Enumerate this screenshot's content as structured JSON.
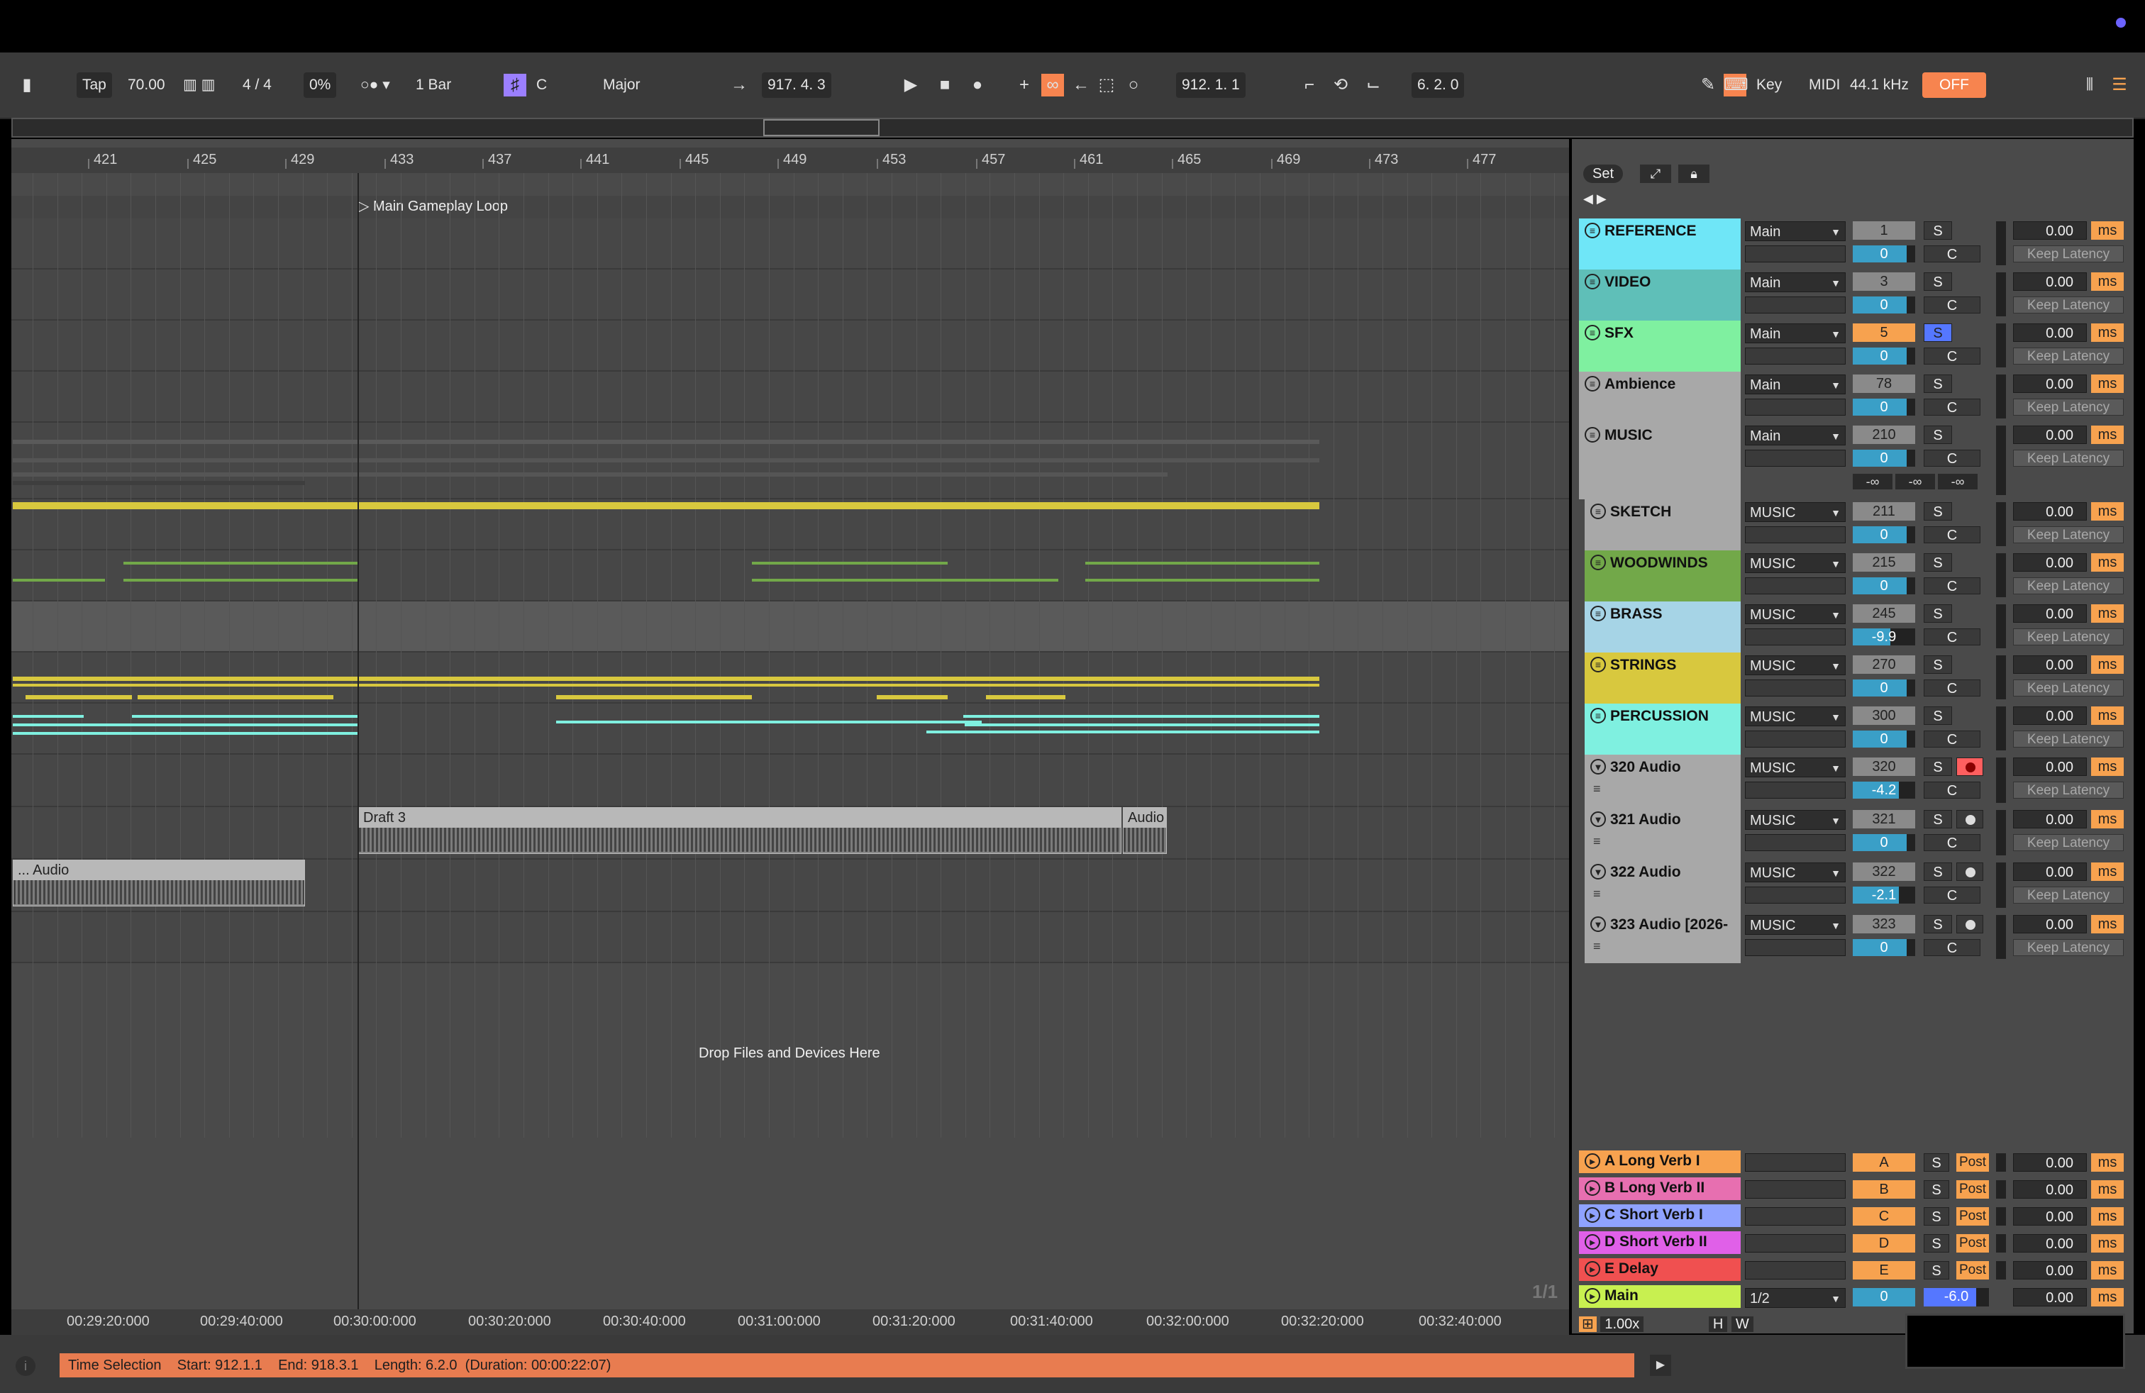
{
  "control_bar": {
    "tap": "Tap",
    "tempo": "70.00",
    "signature": "4 / 4",
    "groove": "0%",
    "quantize": "1 Bar",
    "key": "C",
    "scale": "Major",
    "arrangement_position": "917.  4.  3",
    "loop_start": "912.  1.  1",
    "loop_length": "6.  2.  0",
    "key_label": "Key",
    "midi_label": "MIDI",
    "sample_rate": "44.1 kHz",
    "cpu_overload": "OFF"
  },
  "ruler": [
    "421",
    "425",
    "429",
    "433",
    "437",
    "441",
    "445",
    "449",
    "453",
    "457",
    "461",
    "465",
    "469",
    "473",
    "477"
  ],
  "locator": "Main Gameplay Loop",
  "clips": {
    "draft": "Draft 3",
    "audio_right": "Audio",
    "audio_left": "... Audio"
  },
  "drop_message": "Drop Files and Devices Here",
  "time_ruler": [
    "00:29:20:000",
    "00:29:40:000",
    "00:30:00:000",
    "00:30:20:000",
    "00:30:40:000",
    "00:31:00:000",
    "00:31:20:000",
    "00:31:40:000",
    "00:32:00:000",
    "00:32:20:000",
    "00:32:40:000"
  ],
  "mixer": {
    "set_label": "Set",
    "keep_latency": "Keep Latency",
    "ms": "ms",
    "c_label": "C",
    "s_label": "S",
    "neg_inf": "-∞",
    "tracks": [
      {
        "name": "REFERENCE",
        "color": "#6fe6f7",
        "route": "Main",
        "num": "1",
        "pan": "0",
        "delay": "0.00"
      },
      {
        "name": "VIDEO",
        "color": "#5fbfb8",
        "route": "Main",
        "num": "3",
        "pan": "0",
        "delay": "0.00"
      },
      {
        "name": "SFX",
        "color": "#7ff0a0",
        "route": "Main",
        "num": "5",
        "pan": "0",
        "delay": "0.00"
      },
      {
        "name": "Ambience",
        "color": "#a8a8a8",
        "route": "Main",
        "num": "78",
        "pan": "0",
        "delay": "0.00"
      },
      {
        "name": "MUSIC",
        "color": "#a8a8a8",
        "route": "Main",
        "num": "210",
        "pan": "0",
        "delay": "0.00"
      },
      {
        "name": "SKETCH",
        "color": "#a8a8a8",
        "route": "MUSIC",
        "num": "211",
        "pan": "0",
        "delay": "0.00"
      },
      {
        "name": "WOODWINDS",
        "color": "#72a849",
        "route": "MUSIC",
        "num": "215",
        "pan": "0",
        "delay": "0.00"
      },
      {
        "name": "BRASS",
        "color": "#a6d4e6",
        "route": "MUSIC",
        "num": "245",
        "pan": "-9.9",
        "delay": "0.00"
      },
      {
        "name": "STRINGS",
        "color": "#d8c83e",
        "route": "MUSIC",
        "num": "270",
        "pan": "0",
        "delay": "0.00"
      },
      {
        "name": "PERCUSSION",
        "color": "#7ff0e0",
        "route": "MUSIC",
        "num": "300",
        "pan": "0",
        "delay": "0.00"
      },
      {
        "name": "320 Audio",
        "color": "#a8a8a8",
        "route": "MUSIC",
        "num": "320",
        "pan": "-4.2",
        "delay": "0.00"
      },
      {
        "name": "321 Audio",
        "color": "#a8a8a8",
        "route": "MUSIC",
        "num": "321",
        "pan": "0",
        "delay": "0.00"
      },
      {
        "name": "322 Audio",
        "color": "#a8a8a8",
        "route": "MUSIC",
        "num": "322",
        "pan": "-2.1",
        "delay": "0.00"
      },
      {
        "name": "323 Audio [2026-",
        "color": "#a8a8a8",
        "route": "MUSIC",
        "num": "323",
        "pan": "0",
        "delay": "0.00"
      }
    ],
    "returns": [
      {
        "name": "A Long Verb I",
        "color": "#f7a24f",
        "letter": "A",
        "post": "Post",
        "delay": "0.00"
      },
      {
        "name": "B Long Verb II",
        "color": "#e76fb0",
        "letter": "B",
        "post": "Post",
        "delay": "0.00"
      },
      {
        "name": "C Short Verb I",
        "color": "#8fa2ff",
        "letter": "C",
        "post": "Post",
        "delay": "0.00"
      },
      {
        "name": "D Short Verb II",
        "color": "#e060e8",
        "letter": "D",
        "post": "Post",
        "delay": "0.00"
      },
      {
        "name": "E Delay",
        "color": "#f05050",
        "letter": "E",
        "post": "Post",
        "delay": "0.00"
      }
    ],
    "main": {
      "name": "Main",
      "color": "#c8f050",
      "route": "1/2",
      "num": "0",
      "vol": "-6.0",
      "delay": "0.00"
    }
  },
  "page_count": "1/1",
  "zoom_level": "1.00x",
  "h_label": "H",
  "w_label": "W",
  "status": {
    "label": "Time Selection",
    "start": "Start: 912.1.1",
    "end": "End: 918.3.1",
    "length": "Length: 6.2.0",
    "duration": "(Duration: 00:00:22:07)"
  }
}
